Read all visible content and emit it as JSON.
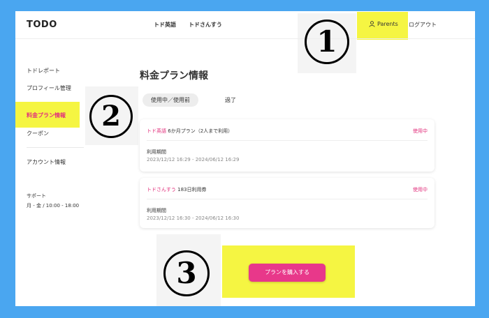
{
  "header": {
    "logo": "TODO",
    "nav": [
      "トド英語",
      "トドさんすう"
    ],
    "parents_label": "Parents",
    "logout_label": "ログアウト"
  },
  "sidebar": {
    "items": [
      {
        "label": "トドレポート",
        "active": false
      },
      {
        "label": "プロフィール管理",
        "active": false
      },
      {
        "label": "料金プラン情報",
        "active": true
      },
      {
        "label": "クーポン",
        "active": false
      },
      {
        "label": "アカウント情報",
        "active": false
      }
    ],
    "support_label": "サポート",
    "support_hours": "月 - 金 / 10:00 - 18:00"
  },
  "main": {
    "title": "料金プラン情報",
    "tabs": [
      {
        "label": "使用中／使用前",
        "active": true
      },
      {
        "label": "過了",
        "active": false
      }
    ],
    "plans": [
      {
        "brand": "トド英語",
        "name": "6か月プラン（2人まで利用）",
        "status": "使用中",
        "period_label": "利用期間",
        "period": "2023/12/12 16:29 - 2024/06/12 16:29"
      },
      {
        "brand": "トドさんすう",
        "name": "183日利用券",
        "status": "使用中",
        "period_label": "利用期間",
        "period": "2023/12/12 16:30 - 2024/06/12 16:30"
      }
    ],
    "cta_label": "プランを購入する"
  },
  "annotations": [
    "1",
    "2",
    "3"
  ],
  "colors": {
    "background": "#4aa6f0",
    "accent": "#e2307c",
    "highlight": "#f5f542"
  }
}
